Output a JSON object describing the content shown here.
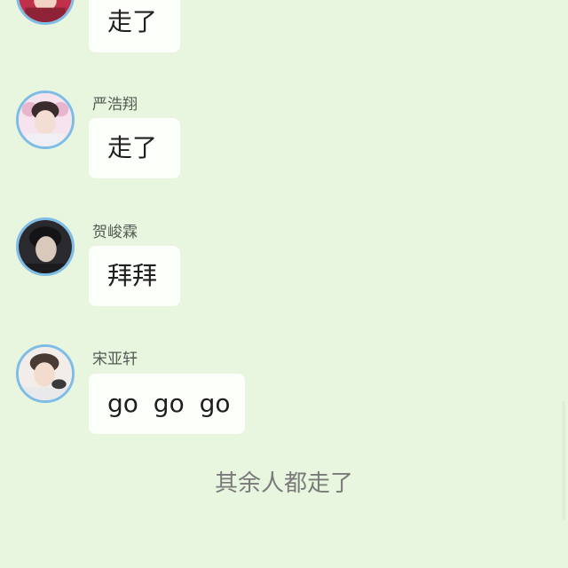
{
  "messages": [
    {
      "sender": "",
      "text": "走了",
      "avatar_icon": "user-avatar-icon"
    },
    {
      "sender": "严浩翔",
      "text": "走了",
      "avatar_icon": "user-avatar-icon"
    },
    {
      "sender": "贺峻霖",
      "text": "拜拜",
      "avatar_icon": "user-avatar-icon"
    },
    {
      "sender": "宋亚轩",
      "text": "go go go",
      "avatar_icon": "user-avatar-icon"
    }
  ],
  "system_note": "其余人都走了",
  "colors": {
    "background": "#e8f5df",
    "bubble": "#fcfffa",
    "avatar_border": "#7dbde6",
    "system_text": "#7a7a7a"
  }
}
